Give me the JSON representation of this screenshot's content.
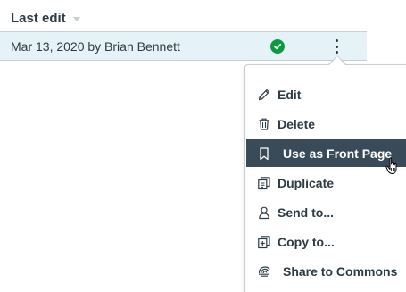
{
  "header": {
    "column_label": "Last edit"
  },
  "row": {
    "last_edit_text": "Mar 13, 2020 by Brian Bennett",
    "status_icon": "check-circle-icon",
    "status_color": "#0b9b3e"
  },
  "menu": {
    "items": [
      {
        "label": "Edit",
        "icon": "pencil-icon"
      },
      {
        "label": "Delete",
        "icon": "trash-icon"
      },
      {
        "label": "Use as Front Page",
        "icon": "bookmark-icon",
        "active": true
      },
      {
        "label": "Duplicate",
        "icon": "duplicate-icon"
      },
      {
        "label": "Send to...",
        "icon": "user-icon"
      },
      {
        "label": "Copy to...",
        "icon": "copy-icon"
      },
      {
        "label": "Share to Commons",
        "icon": "commons-icon"
      }
    ]
  },
  "colors": {
    "text": "#2d3b45",
    "row_highlight": "#e5f2f8",
    "menu_active_bg": "#394b58"
  }
}
